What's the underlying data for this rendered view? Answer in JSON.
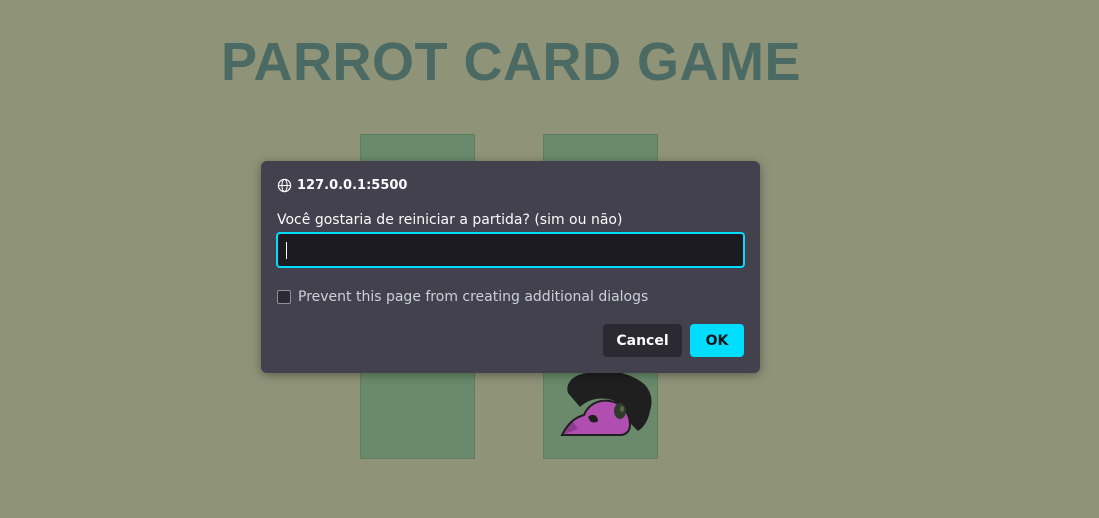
{
  "page": {
    "title": "PARROT CARD GAME"
  },
  "cards": [
    {
      "state": "face-down"
    },
    {
      "state": "face-up",
      "image": "parrot"
    }
  ],
  "dialog": {
    "origin": "127.0.0.1:5500",
    "origin_icon": "globe-icon",
    "message": "Você gostaria de reiniciar a partida? (sim ou não)",
    "input_value": "",
    "checkbox_label": "Prevent this page from creating additional dialogs",
    "checkbox_checked": false,
    "cancel_label": "Cancel",
    "ok_label": "OK"
  },
  "colors": {
    "background": "#8f9377",
    "title": "#4a6a63",
    "card": "#6a8a6b",
    "dialog_bg": "#42414d",
    "accent": "#00ddff"
  }
}
